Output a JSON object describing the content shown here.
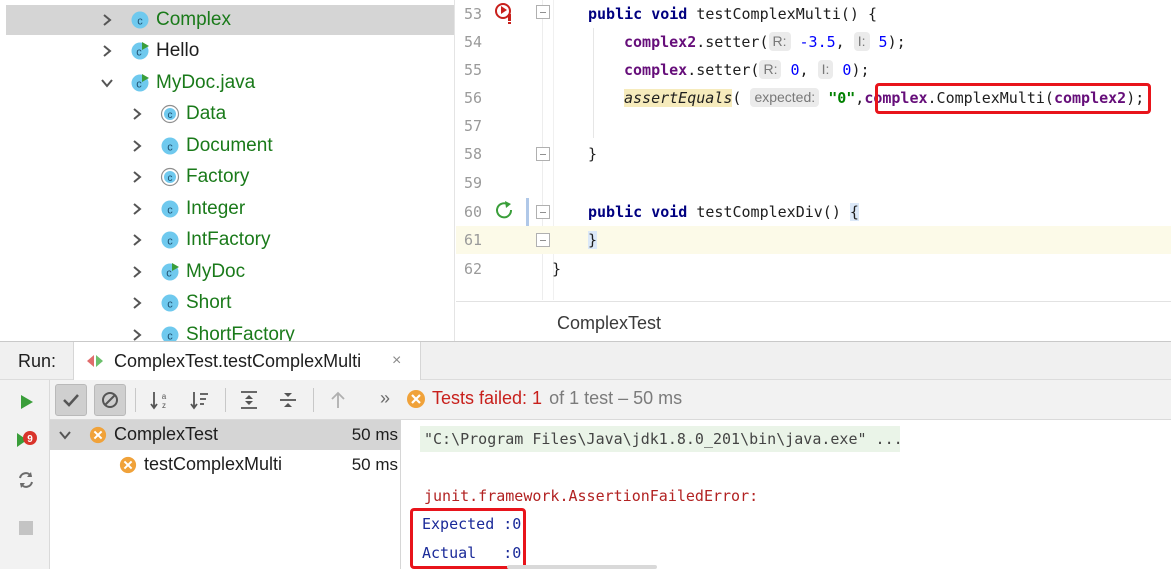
{
  "project_tree": {
    "items": [
      {
        "label": "Complex",
        "icon": "class-icon",
        "expanded": false
      },
      {
        "label": "Hello",
        "icon": "runnable-class-icon",
        "expanded": false
      },
      {
        "label": "MyDoc.java",
        "icon": "runnable-class-icon",
        "expanded": true
      },
      {
        "label": "Data",
        "icon": "abstract-class-icon",
        "expanded": false
      },
      {
        "label": "Document",
        "icon": "class-icon",
        "expanded": false
      },
      {
        "label": "Factory",
        "icon": "abstract-class-icon",
        "expanded": false
      },
      {
        "label": "Integer",
        "icon": "class-icon",
        "expanded": false
      },
      {
        "label": "IntFactory",
        "icon": "class-icon",
        "expanded": false
      },
      {
        "label": "MyDoc",
        "icon": "runnable-class-icon",
        "expanded": false
      },
      {
        "label": "Short",
        "icon": "class-icon",
        "expanded": false
      },
      {
        "label": "ShortFactory",
        "icon": "class-icon",
        "expanded": false
      }
    ]
  },
  "editor": {
    "file_tab": "ComplexTest",
    "lines": [
      {
        "num": "53",
        "parts": {
          "kw1": "public void",
          "name": " testComplexMulti() {"
        }
      },
      {
        "num": "54",
        "parts": {
          "obj": "complex2",
          "call": ".setter(",
          "hint1": "R:",
          "v1": "-3.5",
          "sep": ",",
          "hint2": "I:",
          "v2": "5",
          "end": ");"
        }
      },
      {
        "num": "55",
        "parts": {
          "obj": "complex",
          "call": ".setter(",
          "hint1": "R:",
          "v1": "0",
          "sep": ",",
          "hint2": "I:",
          "v2": "0",
          "end": ");"
        }
      },
      {
        "num": "56",
        "parts": {
          "fn": "assertEquals",
          "open": "(",
          "hint1": "expected:",
          "v1": "\"0\"",
          "sep": ",",
          "obj": "complex",
          "call": ".ComplexMulti(",
          "arg": "complex2",
          "end": ");"
        }
      },
      {
        "num": "57"
      },
      {
        "num": "58",
        "parts": {
          "close": "}"
        }
      },
      {
        "num": "59"
      },
      {
        "num": "60",
        "parts": {
          "kw1": "public void",
          "name": " testComplexDiv() ",
          "brace": "{"
        }
      },
      {
        "num": "61",
        "parts": {
          "close": "}"
        }
      },
      {
        "num": "62",
        "parts": {
          "close": "}"
        }
      }
    ]
  },
  "run_panel": {
    "label": "Run:",
    "tab_title": "ComplexTest.testComplexMulti",
    "tab_close": "×",
    "status": {
      "label": "Tests failed:",
      "failed": "1",
      "rest": "of 1 test – 50 ms"
    },
    "overflow": "»",
    "test_tree": [
      {
        "label": "ComplexTest",
        "time": "50 ms",
        "status": "failed"
      },
      {
        "label": "testComplexMulti",
        "time": "50 ms",
        "status": "failed"
      }
    ],
    "console": {
      "command": "\"C:\\Program Files\\Java\\jdk1.8.0_201\\bin\\java.exe\" ...",
      "error": "junit.framework.AssertionFailedError:",
      "expected": "Expected :0",
      "actual": "Actual   :0"
    }
  },
  "colors": {
    "accent_fail": "#c8201c",
    "class_name_green": "#1a7a1a",
    "highlight_box": "#e8141b",
    "run_green": "#3a9e3a"
  }
}
